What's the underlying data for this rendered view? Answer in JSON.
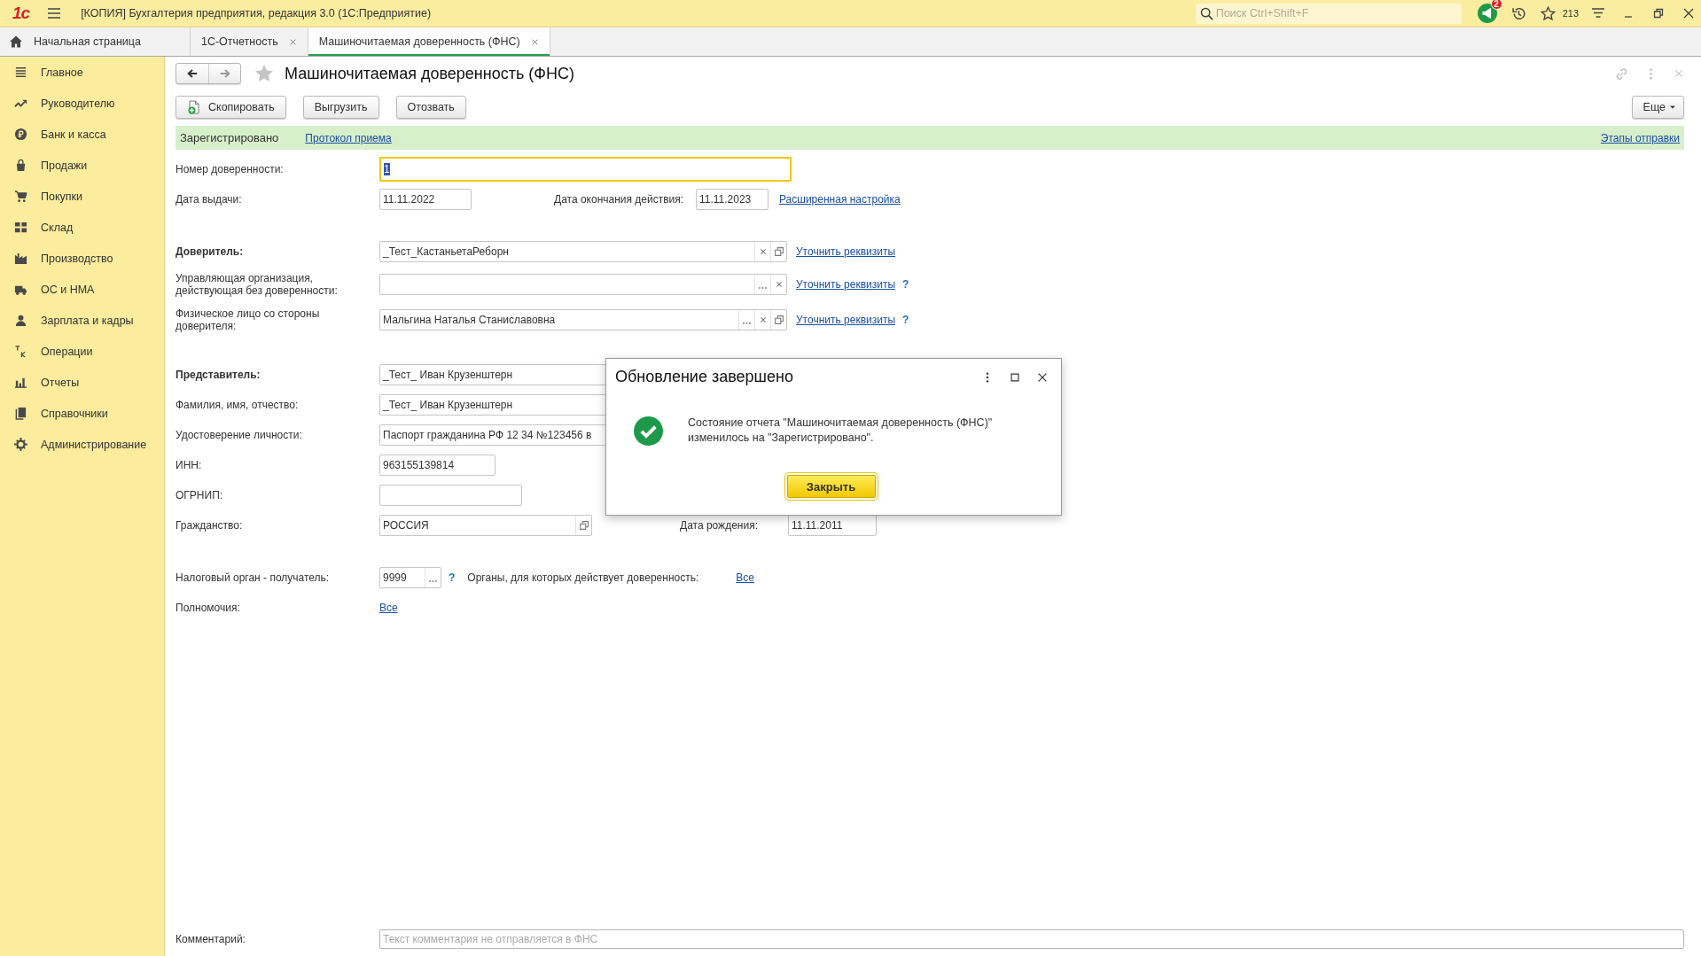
{
  "window": {
    "logo": "1с",
    "title": "[КОПИЯ] Бухгалтерия предприятия, редакция 3.0 (1С:Предприятие)",
    "search_placeholder": "Поиск Ctrl+Shift+F",
    "notification_count": "2",
    "counter": "213"
  },
  "tabs": [
    {
      "label": "Начальная страница",
      "kind": "home",
      "selected": false
    },
    {
      "label": "1С-Отчетность",
      "kind": "closable",
      "selected": false
    },
    {
      "label": "Машиночитаемая доверенность (ФНС)",
      "kind": "closable",
      "selected": true
    }
  ],
  "sidebar": {
    "items": [
      {
        "label": "Главное"
      },
      {
        "label": "Руководителю"
      },
      {
        "label": "Банк и касса"
      },
      {
        "label": "Продажи"
      },
      {
        "label": "Покупки"
      },
      {
        "label": "Склад"
      },
      {
        "label": "Производство"
      },
      {
        "label": "ОС и НМА"
      },
      {
        "label": "Зарплата и кадры"
      },
      {
        "label": "Операции"
      },
      {
        "label": "Отчеты"
      },
      {
        "label": "Справочники"
      },
      {
        "label": "Администрирование"
      }
    ]
  },
  "document": {
    "title": "Машиночитаемая доверенность (ФНС)",
    "favorite": false,
    "toolbar": [
      {
        "label": "Скопировать",
        "kind": "copy"
      },
      {
        "label": "Выгрузить",
        "kind": "plain"
      },
      {
        "label": "Отозвать",
        "kind": "plain"
      }
    ],
    "more_button": "Еще",
    "status": {
      "text": "Зарегистрировано",
      "link": "Протокол приема",
      "right_link": "Этапы отправки"
    },
    "sections": [
      [
        {
          "kind": "number",
          "label": "Номер доверенности:",
          "bold": false,
          "value": "1",
          "focused": true
        },
        {
          "kind": "dates",
          "label": "Дата выдачи:",
          "bold": false,
          "value": "11.11.2022",
          "label2": "Дата окончания действия:",
          "value2": "11.11.2023",
          "link": "Расширенная настройка"
        }
      ],
      [
        {
          "kind": "principal",
          "label": "Доверитель:",
          "bold": true,
          "value": "_Тест_КастаньетаРеборн",
          "link": "Уточнить реквизиты"
        },
        {
          "kind": "organization",
          "label": "Управляющая организация, действующая без доверенности:",
          "bold": false,
          "link": "Уточнить реквизиты",
          "help": "?"
        },
        {
          "kind": "individual",
          "label": "Физическое лицо со стороны доверителя:",
          "bold": false,
          "value": "Мальгина Наталья Станиславовна",
          "link": "Уточнить реквизиты",
          "help": "?"
        }
      ],
      [
        {
          "kind": "text",
          "label": "Представитель:",
          "bold": true,
          "value": "_Тест_ Иван Крузенштерн"
        },
        {
          "kind": "text",
          "label": "Фамилия, имя, отчество:",
          "bold": false,
          "value": "_Тест_ Иван Крузенштерн"
        },
        {
          "kind": "text",
          "label": "Удостоверение личности:",
          "bold": false,
          "value": "Паспорт гражданина РФ 12 34 №123456 в"
        },
        {
          "kind": "short",
          "label": "ИНН:",
          "bold": false,
          "value": "963155139814"
        },
        {
          "kind": "medium",
          "label": "ОГРНИП:",
          "bold": false
        },
        {
          "kind": "citizenship",
          "label": "Гражданство:",
          "bold": false,
          "value": "РОССИЯ",
          "label2": "Дата рождения:",
          "value2": "11.11.2011"
        }
      ],
      [
        {
          "kind": "tax",
          "label": "Налоговый орган - получатель:",
          "bold": false,
          "value": "9999",
          "help": "?",
          "label2": "Органы, для которых действует доверенность:",
          "link": "Все"
        },
        {
          "kind": "link",
          "label": "Полномочия:",
          "bold": false,
          "link": "Все"
        }
      ]
    ],
    "comment": {
      "label": "Комментарий:",
      "placeholder": "Текст комментария не отправляется в ФНС"
    }
  },
  "dialog": {
    "title": "Обновление завершено",
    "message_lines": [
      "Состояние отчета \"Машиночитаемая доверенность (ФНС)\"",
      "изменилось на \"Зарегистрировано\"."
    ],
    "button": "Закрыть"
  }
}
